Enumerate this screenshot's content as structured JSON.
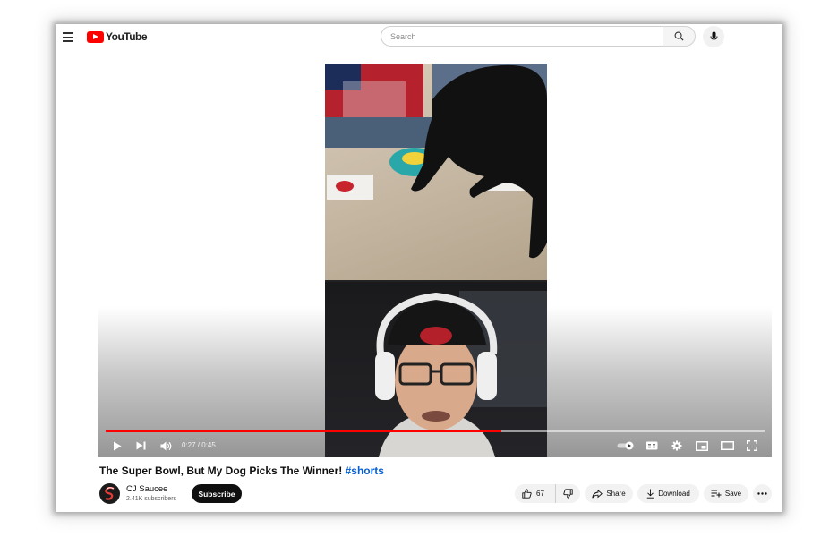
{
  "header": {
    "logo_text": "YouTube",
    "search": {
      "placeholder": "Search",
      "value": ""
    },
    "icons": [
      "menu-icon",
      "search-icon",
      "mic-icon"
    ]
  },
  "player": {
    "time": "0:27 / 0:45",
    "progress_fraction": 0.6,
    "icons": [
      "play-icon",
      "next-icon",
      "volume-icon",
      "autoplay-toggle-icon",
      "captions-icon",
      "settings-icon",
      "miniplayer-icon",
      "theater-icon",
      "fullscreen-icon"
    ]
  },
  "video": {
    "title": "The Super Bowl, But My Dog Picks The Winner!",
    "hashtag": "#shorts"
  },
  "channel": {
    "name": "CJ Saucee",
    "subscribers": "2.41K subscribers",
    "subscribe_label": "Subscribe"
  },
  "actions": {
    "like_count": "67",
    "share_label": "Share",
    "download_label": "Download",
    "save_label": "Save"
  },
  "colors": {
    "brand_red": "#ff0000",
    "link_blue": "#065fd4",
    "text_primary": "#0f0f0f"
  }
}
